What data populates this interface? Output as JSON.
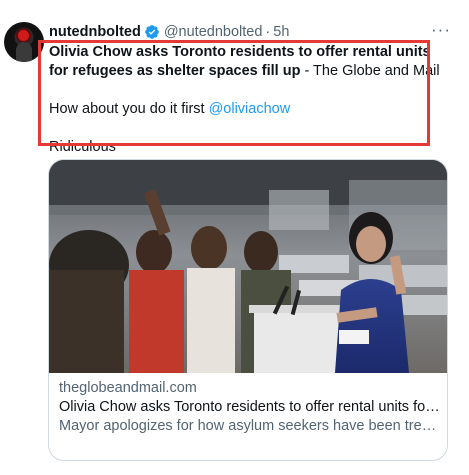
{
  "author": {
    "display_name": "nutednbolted",
    "handle": "@nutednbolted",
    "separator": "·",
    "time": "5h",
    "verified_icon": "verified-badge-icon"
  },
  "more_menu": "···",
  "tweet": {
    "headline": "Olivia Chow asks Toronto residents to offer rental units for refugees as shelter spaces fill up",
    "source_suffix": " - The Globe and Mail",
    "line2_prefix": "How about you do it first ",
    "mention": "@oliviachow",
    "line3": "Ridiculous"
  },
  "link_card": {
    "image_alt": "Photo of Olivia Chow speaking at a podium with microphones inside a shelter with cots and people in the background",
    "domain": "theglobeandmail.com",
    "title": "Olivia Chow asks Toronto residents to offer rental units for refugees as shelter spaces fill up",
    "description": "Mayor apologizes for how asylum seekers have been treated, says city will help where it can but urges Ottawa to provide more support"
  },
  "colors": {
    "accent": "#1d9bf0",
    "highlight_box": "#e53935",
    "secondary_text": "#536471"
  }
}
